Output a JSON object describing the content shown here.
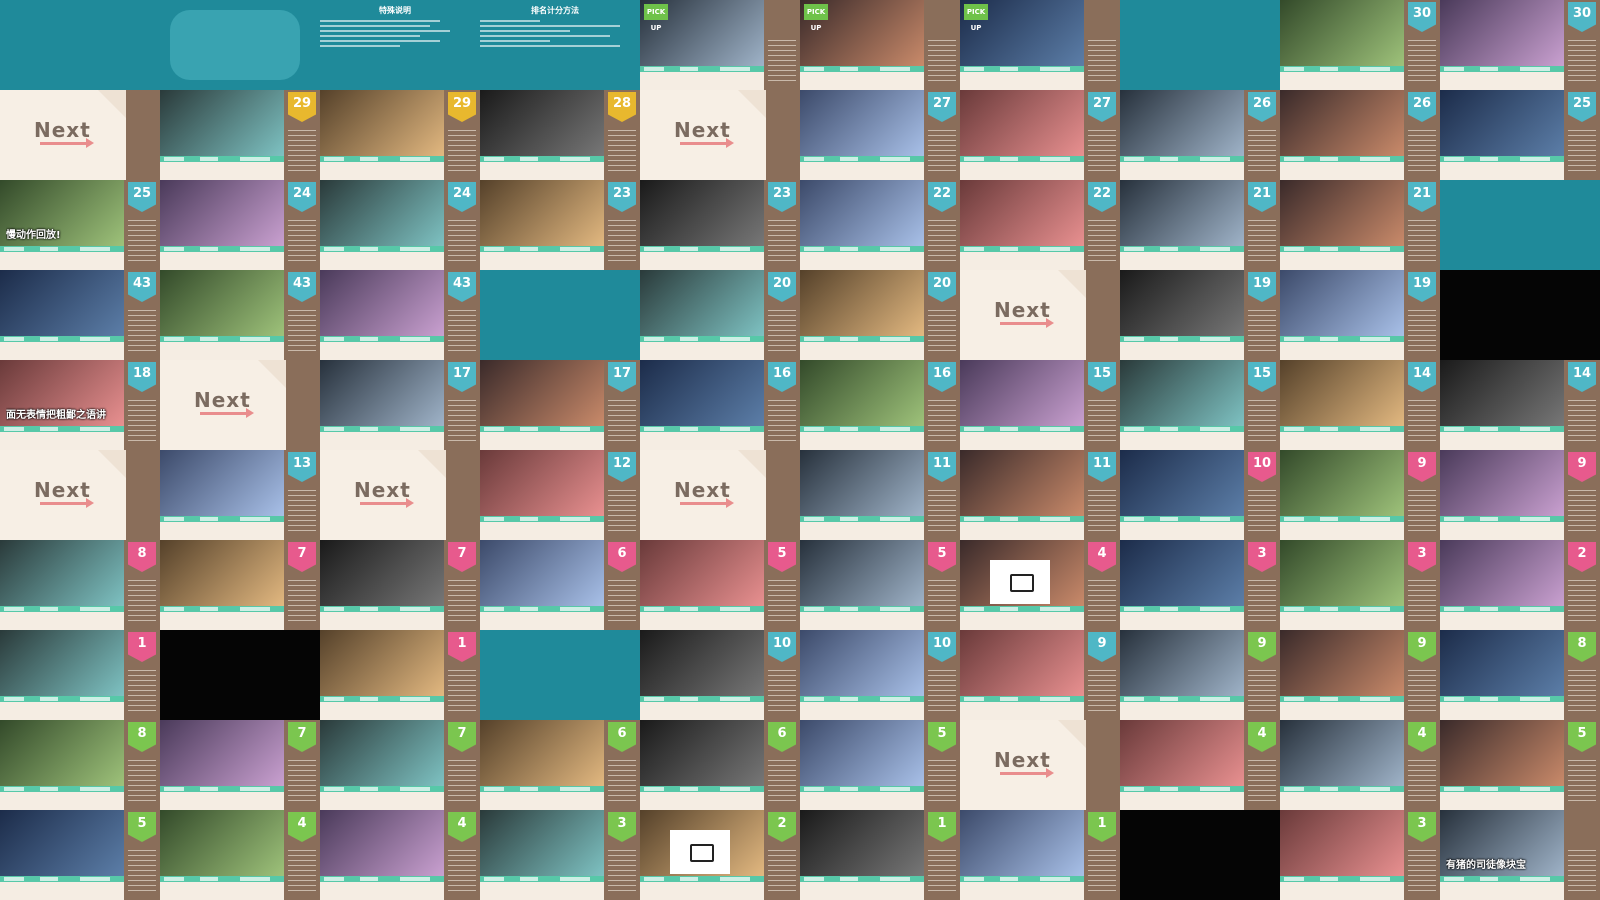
{
  "header": {
    "left_title": "特殊说明",
    "right_title": "排名计分方法",
    "left_lines": [
      "",
      "",
      "",
      "",
      ""
    ],
    "right_lines": [
      "",
      "",
      "",
      "",
      "",
      ""
    ]
  },
  "cards": {
    "next_label": "Next",
    "pickup_label": "PICK UP",
    "captions": {
      "c": "慢动作回放!",
      "d": "面无表情把粗鄙之语讲",
      "e": "有猪的司徒像块宝"
    }
  },
  "colors": {
    "teal": "#1f8a9a",
    "rank_blue": "#4fb7c6",
    "rank_green": "#7bc64f",
    "rank_pink": "#e75a8d",
    "rank_yellow": "#e8b82e",
    "card_bg": "#f5ede3",
    "side_brown": "#8a6e5a"
  },
  "icons": {
    "tv": "tv-icon",
    "arrow": "arrow-right-icon"
  },
  "layout_rows": [
    [
      {
        "t": "header"
      },
      {
        "t": "header"
      },
      {
        "t": "header"
      },
      {
        "t": "header"
      },
      {
        "t": "pickup"
      },
      {
        "t": "pickup"
      },
      {
        "t": "pickup"
      },
      {
        "t": "teal"
      },
      {
        "t": "video",
        "r": "30",
        "c": "blue"
      },
      {
        "t": "video",
        "r": "30",
        "c": "blue"
      }
    ],
    [
      {
        "t": "next"
      },
      {
        "t": "video",
        "r": "29",
        "c": "yellow"
      },
      {
        "t": "video",
        "r": "29",
        "c": "yellow"
      },
      {
        "t": "video",
        "r": "28",
        "c": "yellow"
      },
      {
        "t": "next"
      },
      {
        "t": "video",
        "r": "27",
        "c": "blue"
      },
      {
        "t": "video",
        "r": "27",
        "c": "blue"
      },
      {
        "t": "video",
        "r": "26",
        "c": "blue"
      },
      {
        "t": "video",
        "r": "26",
        "c": "blue"
      },
      {
        "t": "video",
        "r": "25",
        "c": "blue"
      }
    ],
    [
      {
        "t": "video",
        "r": "25",
        "c": "blue",
        "cap": "c"
      },
      {
        "t": "video",
        "r": "24",
        "c": "blue"
      },
      {
        "t": "video",
        "r": "24",
        "c": "blue"
      },
      {
        "t": "video",
        "r": "23",
        "c": "blue"
      },
      {
        "t": "video",
        "r": "23",
        "c": "blue"
      },
      {
        "t": "video",
        "r": "22",
        "c": "blue"
      },
      {
        "t": "video",
        "r": "22",
        "c": "blue"
      },
      {
        "t": "video",
        "r": "21",
        "c": "blue"
      },
      {
        "t": "video",
        "r": "21",
        "c": "blue"
      },
      {
        "t": "teal"
      }
    ],
    [
      {
        "t": "video",
        "r": "43",
        "c": "blue"
      },
      {
        "t": "video",
        "r": "43",
        "c": "blue"
      },
      {
        "t": "video",
        "r": "43",
        "c": "blue"
      },
      {
        "t": "teal"
      },
      {
        "t": "video",
        "r": "20",
        "c": "blue"
      },
      {
        "t": "video",
        "r": "20",
        "c": "blue"
      },
      {
        "t": "next"
      },
      {
        "t": "video",
        "r": "19",
        "c": "blue"
      },
      {
        "t": "video",
        "r": "19",
        "c": "blue"
      },
      {
        "t": "black"
      }
    ],
    [
      {
        "t": "video",
        "r": "18",
        "c": "blue",
        "cap": "d"
      },
      {
        "t": "next"
      },
      {
        "t": "video",
        "r": "17",
        "c": "blue"
      },
      {
        "t": "video",
        "r": "17",
        "c": "blue"
      },
      {
        "t": "video",
        "r": "16",
        "c": "blue"
      },
      {
        "t": "video",
        "r": "16",
        "c": "blue"
      },
      {
        "t": "video",
        "r": "15",
        "c": "blue"
      },
      {
        "t": "video",
        "r": "15",
        "c": "blue"
      },
      {
        "t": "video",
        "r": "14",
        "c": "blue"
      },
      {
        "t": "video",
        "r": "14",
        "c": "blue"
      }
    ],
    [
      {
        "t": "next"
      },
      {
        "t": "video",
        "r": "13",
        "c": "blue"
      },
      {
        "t": "next"
      },
      {
        "t": "video",
        "r": "12",
        "c": "blue"
      },
      {
        "t": "next"
      },
      {
        "t": "video",
        "r": "11",
        "c": "blue"
      },
      {
        "t": "video",
        "r": "11",
        "c": "blue"
      },
      {
        "t": "video",
        "r": "10",
        "c": "pink"
      },
      {
        "t": "video",
        "r": "9",
        "c": "pink"
      },
      {
        "t": "video",
        "r": "9",
        "c": "pink"
      }
    ],
    [
      {
        "t": "video",
        "r": "8",
        "c": "pink"
      },
      {
        "t": "video",
        "r": "7",
        "c": "pink"
      },
      {
        "t": "video",
        "r": "7",
        "c": "pink"
      },
      {
        "t": "video",
        "r": "6",
        "c": "pink"
      },
      {
        "t": "video",
        "r": "5",
        "c": "pink"
      },
      {
        "t": "video",
        "r": "5",
        "c": "pink"
      },
      {
        "t": "video",
        "r": "4",
        "c": "pink",
        "tv": true
      },
      {
        "t": "video",
        "r": "3",
        "c": "pink"
      },
      {
        "t": "video",
        "r": "3",
        "c": "pink"
      },
      {
        "t": "video",
        "r": "2",
        "c": "pink"
      }
    ],
    [
      {
        "t": "video",
        "r": "1",
        "c": "pink"
      },
      {
        "t": "black"
      },
      {
        "t": "video",
        "r": "1",
        "c": "pink"
      },
      {
        "t": "teal"
      },
      {
        "t": "video",
        "r": "10",
        "c": "blue"
      },
      {
        "t": "video",
        "r": "10",
        "c": "blue"
      },
      {
        "t": "video",
        "r": "9",
        "c": "blue"
      },
      {
        "t": "video",
        "r": "9",
        "c": "green"
      },
      {
        "t": "video",
        "r": "9",
        "c": "green"
      },
      {
        "t": "video",
        "r": "8",
        "c": "green"
      }
    ],
    [
      {
        "t": "video",
        "r": "8",
        "c": "green"
      },
      {
        "t": "video",
        "r": "7",
        "c": "green"
      },
      {
        "t": "video",
        "r": "7",
        "c": "green"
      },
      {
        "t": "video",
        "r": "6",
        "c": "green"
      },
      {
        "t": "video",
        "r": "6",
        "c": "green"
      },
      {
        "t": "video",
        "r": "5",
        "c": "green"
      },
      {
        "t": "next"
      },
      {
        "t": "video",
        "r": "4",
        "c": "green"
      },
      {
        "t": "video",
        "r": "4",
        "c": "green"
      },
      {
        "t": "video",
        "r": "5",
        "c": "green"
      }
    ],
    [
      {
        "t": "video",
        "r": "5",
        "c": "green"
      },
      {
        "t": "video",
        "r": "4",
        "c": "green"
      },
      {
        "t": "video",
        "r": "4",
        "c": "green"
      },
      {
        "t": "video",
        "r": "3",
        "c": "green"
      },
      {
        "t": "video",
        "r": "2",
        "c": "green",
        "tv": true
      },
      {
        "t": "video",
        "r": "1",
        "c": "green"
      },
      {
        "t": "video",
        "r": "1",
        "c": "green"
      },
      {
        "t": "black"
      },
      {
        "t": "video",
        "r": "3",
        "c": "green"
      },
      {
        "t": "video",
        "r": "",
        "c": "green",
        "cap": "e"
      }
    ]
  ]
}
